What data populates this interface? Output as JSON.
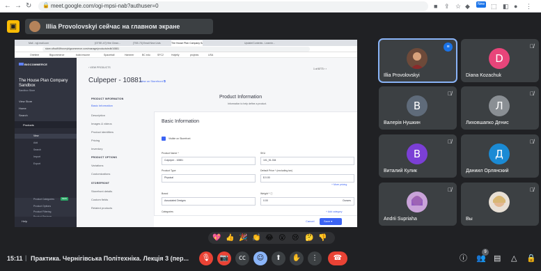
{
  "browser": {
    "url": "meet.google.com/ogi-mpsi-nab?authuser=0",
    "new_badge": "New"
  },
  "banner": {
    "presenting_text": "Illia Provolovskyi сейчас на главном экране"
  },
  "shared_screen": {
    "tabs": [
      "Mail - ngl.mail.com",
      "[GTSE-47] Hire Clean...",
      "[TSE-73] Email New Lists",
      "The House Plan Company Sa...",
      "Update/Contents - Learnin..."
    ],
    "address": "store-sfhcd94fhw.mybigcommerce.com/manage/products/edit/10881",
    "bookmarks": [
      "Onetime",
      "Bigcommerce",
      "build resume",
      "Spaceball",
      "Hammer",
      "BC edu",
      "SFC2",
      "Hotjelly",
      "projects",
      "USA"
    ],
    "sidebar": {
      "brand": "BIGCOMMERCE",
      "store_name": "The House Plan Company Sandbox",
      "store_sub": "Sandbox Store",
      "nav": [
        "View Store",
        "Home",
        "Search"
      ],
      "products_head": "Products",
      "products_items": [
        "View",
        "Add",
        "Search",
        "Import",
        "Export",
        "Product Categories",
        "Product Options",
        "Product Filtering",
        "Product Reviews",
        "Price Lists"
      ],
      "new_label": "NEW",
      "help": "Help"
    },
    "main": {
      "back": "‹ VIEW PRODUCTS",
      "title": "Culpeper - 10881",
      "view_storefront": "View on Storefront ⧉",
      "pager": "1 of 8773  ‹  ›",
      "left_nav_head1": "PRODUCT INFORMATION",
      "left_nav1": [
        "Basic Information",
        "Description",
        "Images & videos",
        "Product identifiers",
        "Pricing",
        "Inventory"
      ],
      "left_nav_head2": "PRODUCT OPTIONS",
      "left_nav2": [
        "Variations",
        "Customizations"
      ],
      "left_nav_head3": "STOREFRONT",
      "left_nav3": [
        "Storefront details",
        "Custom fields",
        "Related products"
      ],
      "pi_title": "Product Information",
      "pi_sub": "Information to help define a product.",
      "basic_title": "Basic Information",
      "visible_label": "Visible on Storefront",
      "product_name_label": "Product Name *",
      "product_name_value": "Culpeper - 10881",
      "sku_label": "SKU",
      "sku_value": "101_51.334",
      "product_type_label": "Product Type",
      "product_type_value": "Physical",
      "default_price_label": "Default Price * (excluding tax)",
      "default_price_value": "$  0.00",
      "more_pricing": "+ More pricing",
      "brand_label": "Brand",
      "brand_value": "Associated Designs",
      "weight_label": "Weight * ⓘ",
      "weight_value": "0.00",
      "weight_unit": "Ounces",
      "categories_label": "Categories",
      "add_category": "+ Add category",
      "cancel": "Cancel",
      "save": "Save  ▾"
    }
  },
  "participants": [
    {
      "name": "Illia Provolovskyi",
      "initial": "",
      "avatar_color": "",
      "muted": false,
      "speaking": true
    },
    {
      "name": "Diana Kozachuk",
      "initial": "D",
      "avatar_color": "#e8457a",
      "muted": true
    },
    {
      "name": "Валерія Нушкин",
      "initial": "В",
      "avatar_color": "#5f6b7a",
      "muted": true
    },
    {
      "name": "Лиховшапко Денис",
      "initial": "Л",
      "avatar_color": "#8a8f94",
      "muted": true
    },
    {
      "name": "Виталий Кулик",
      "initial": "В",
      "avatar_color": "#7b3fd6",
      "muted": true
    },
    {
      "name": "Даниил Орлянский",
      "initial": "Д",
      "avatar_color": "#1a8ad4",
      "muted": true
    },
    {
      "name": "Andrii Supriaha",
      "initial": "",
      "avatar_color": "",
      "muted": true
    },
    {
      "name": "Вы",
      "initial": "",
      "avatar_color": "",
      "muted": true
    }
  ],
  "reactions": [
    "💖",
    "👍",
    "🎉",
    "👏",
    "😂",
    "😮",
    "😢",
    "🤔",
    "👎"
  ],
  "bottom": {
    "time": "15:11",
    "separator": "|",
    "meeting_title": "Практика. Чернігівська Політехніка. Лекція 3 (пер...",
    "people_count": "9"
  },
  "colors": {
    "meet_bg": "#202124",
    "tile_bg": "#3c4043",
    "active_outline": "#8ab4f8",
    "end_call": "#ea4335",
    "bc_blue": "#3c64f4"
  }
}
